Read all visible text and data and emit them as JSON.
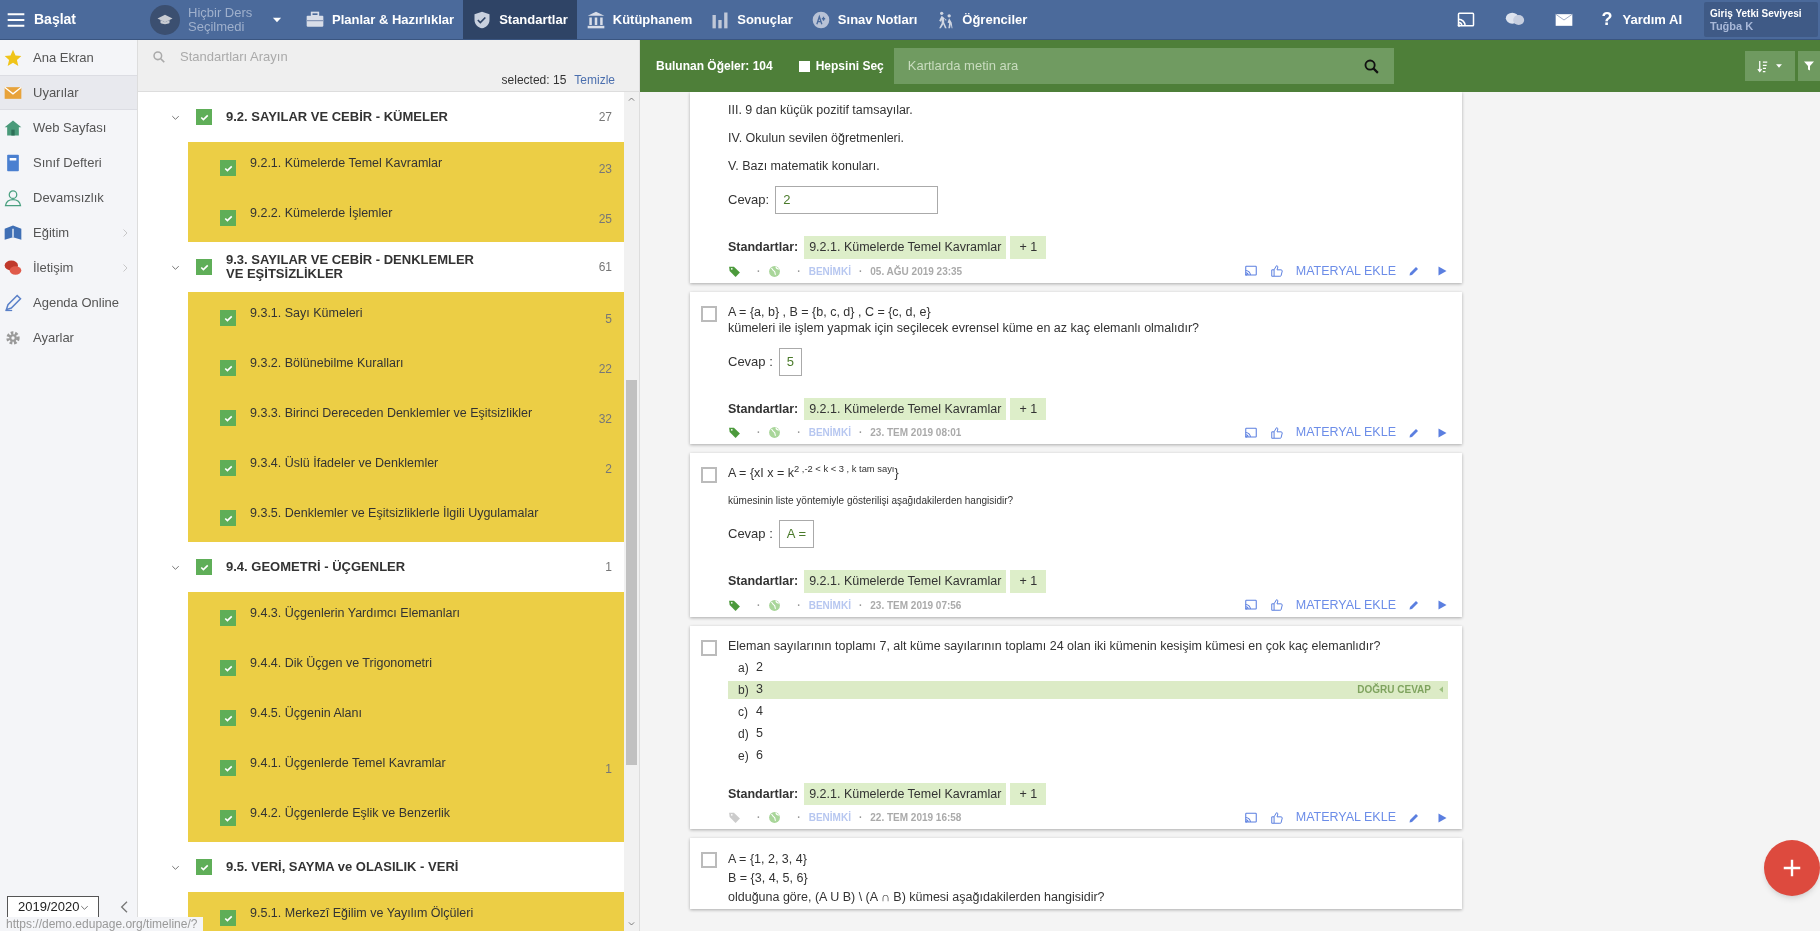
{
  "topbar": {
    "menu_label": "Başlat",
    "course": "Hiçbir Ders Seçilmedi",
    "tabs": [
      {
        "label": "Planlar & Hazırlıklar",
        "selected": false
      },
      {
        "label": "Standartlar",
        "selected": true
      },
      {
        "label": "Kütüphanem",
        "selected": false
      },
      {
        "label": "Sonuçlar",
        "selected": false
      },
      {
        "label": "Sınav Notları",
        "selected": false
      },
      {
        "label": "Öğrenciler",
        "selected": false
      }
    ],
    "help_icon": "?",
    "help": "Yardım AI",
    "user": {
      "role": "Giriş Yetki Seviyesi",
      "name": "Tuğba K"
    }
  },
  "sidebar": {
    "items": [
      {
        "label": "Ana Ekran",
        "selected": false,
        "submenu": false
      },
      {
        "label": "Uyarılar",
        "selected": true,
        "submenu": false
      },
      {
        "label": "Web Sayfası",
        "selected": false,
        "submenu": false
      },
      {
        "label": "Sınıf Defteri",
        "selected": false,
        "submenu": false
      },
      {
        "label": "Devamsızlık",
        "selected": false,
        "submenu": false
      },
      {
        "label": "Eğitim",
        "selected": false,
        "submenu": true
      },
      {
        "label": "İletişim",
        "selected": false,
        "submenu": true
      },
      {
        "label": "Agenda Online",
        "selected": false,
        "submenu": false
      },
      {
        "label": "Ayarlar",
        "selected": false,
        "submenu": false
      }
    ],
    "year": "2019/2020"
  },
  "standards": {
    "search_placeholder": "Standartları Arayın",
    "selected_text": "selected: 15",
    "clear": "Temizle",
    "groups": [
      {
        "title": "9.2. SAYILAR VE CEBİR - KÜMELER",
        "count": "27",
        "checked": true,
        "expanded": true,
        "children": [
          {
            "label": "9.2.1. Kümelerde Temel Kavramlar",
            "count": "23",
            "checked": true
          },
          {
            "label": "9.2.2. Kümelerde İşlemler",
            "count": "25",
            "checked": true
          }
        ]
      },
      {
        "title": "9.3. SAYILAR VE CEBİR - DENKLEMLER VE EŞİTSİZLİKLER",
        "count": "61",
        "checked": true,
        "expanded": true,
        "children": [
          {
            "label": "9.3.1. Sayı Kümeleri",
            "count": "5",
            "checked": true
          },
          {
            "label": "9.3.2. Bölünebilme Kuralları",
            "count": "22",
            "checked": true
          },
          {
            "label": "9.3.3. Birinci Dereceden Denklemler ve Eşitsizlikler",
            "count": "32",
            "checked": true
          },
          {
            "label": "9.3.4. Üslü İfadeler ve Denklemler",
            "count": "2",
            "checked": true
          },
          {
            "label": "9.3.5. Denklemler ve Eşitsizliklerle İlgili Uygulamalar",
            "checked": true
          }
        ]
      },
      {
        "title": "9.4. GEOMETRİ - ÜÇGENLER",
        "count": "1",
        "checked": true,
        "expanded": true,
        "children": [
          {
            "label": "9.4.3. Üçgenlerin Yardımcı Elemanları",
            "checked": true
          },
          {
            "label": "9.4.4. Dik Üçgen ve Trigonometri",
            "checked": true
          },
          {
            "label": "9.4.5. Üçgenin Alanı",
            "checked": true
          },
          {
            "label": "9.4.1. Üçgenlerde Temel Kavramlar",
            "count": "1",
            "checked": true
          },
          {
            "label": "9.4.2. Üçgenlerde Eşlik ve Benzerlik",
            "checked": true
          }
        ]
      },
      {
        "title": "9.5. VERİ, SAYMA ve OLASILIK - VERİ",
        "checked": true,
        "expanded": true,
        "children": [
          {
            "label": "9.5.1. Merkezî Eğilim ve Yayılım Ölçüleri",
            "checked": true
          }
        ]
      }
    ]
  },
  "toolbar": {
    "found": "Bulunan Öğeler: 104",
    "select_all": {
      "label": "Hepsini Seç",
      "checked": false
    },
    "search_placeholder": "Kartlarda metin ara"
  },
  "cards": [
    {
      "kind": "open",
      "lines": [
        {
          "text": "III. 9 dan küçük pozitif tamsayılar.",
          "small": false
        },
        {
          "text": "IV. Okulun sevilen öğretmenleri.",
          "small": false
        },
        {
          "text": "V. Bazı matematik konuları.",
          "small": false
        }
      ],
      "answer": {
        "label": "Cevap:",
        "value": "2",
        "wide": true
      },
      "standards": {
        "label": "Standartlar:",
        "tag": "9.2.1. Kümelerde Temel Kavramlar",
        "more": "+ 1"
      },
      "meta": {
        "tagged": true,
        "dots": [
          "·",
          "·",
          "·"
        ],
        "owner": "BENİMKİ",
        "date": "05. AĞU 2019 23:35",
        "action": "MATERYAL EKLE"
      }
    },
    {
      "kind": "open",
      "checked": false,
      "lines": [
        {
          "text": "A = {a, b} , B = {b, c, d} , C = {c, d, e}",
          "small": false
        },
        {
          "text": "kümeleri ile işlem yapmak için seçilecek evrensel küme en az kaç elemanlı olmalıdır?",
          "small": false
        }
      ],
      "answer": {
        "label": "Cevap :",
        "value": "5",
        "wide": false
      },
      "standards": {
        "label": "Standartlar:",
        "tag": "9.2.1. Kümelerde Temel Kavramlar",
        "more": "+ 1"
      },
      "meta": {
        "tagged": true,
        "dots": [
          "·",
          "·",
          "·"
        ],
        "owner": "BENİMKİ",
        "date": "23. TEM 2019 08:01",
        "action": "MATERYAL EKLE"
      }
    },
    {
      "kind": "open",
      "checked": false,
      "lines": [
        {
          "text": "A = {xI x = k$^{2 ,-2 < k < 3 , k tam sayı}$}",
          "small": false
        },
        {
          "text": "kümesinin liste yöntemiyle gösterilişi aşağıdakilerden hangisidir?",
          "small": true
        }
      ],
      "answer": {
        "label": "Cevap :",
        "value": "A =",
        "wide": false
      },
      "standards": {
        "label": "Standartlar:",
        "tag": "9.2.1. Kümelerde Temel Kavramlar",
        "more": "+ 1"
      },
      "meta": {
        "tagged": true,
        "dots": [
          "·",
          "·",
          "·"
        ],
        "owner": "BENİMKİ",
        "date": "23. TEM 2019 07:56",
        "action": "MATERYAL EKLE"
      }
    },
    {
      "kind": "choice",
      "checked": false,
      "lines": [
        {
          "text": "Eleman sayılarının toplamı 7, alt küme sayılarının toplamı 24 olan iki kümenin kesişim kümesi en çok kaç elemanlıdır?",
          "small": false
        }
      ],
      "options": [
        {
          "letter": "a)",
          "text": "2",
          "correct": false
        },
        {
          "letter": "b)",
          "text": "3",
          "correct": true
        },
        {
          "letter": "c)",
          "text": "4",
          "correct": false
        },
        {
          "letter": "d)",
          "text": "5",
          "correct": false
        },
        {
          "letter": "e)",
          "text": "6",
          "correct": false
        }
      ],
      "correct_label": "DOĞRU CEVAP",
      "standards": {
        "label": "Standartlar:",
        "tag": "9.2.1. Kümelerde Temel Kavramlar",
        "more": "+ 1"
      },
      "meta": {
        "tagged": false,
        "dots": [
          "·",
          "·",
          "·"
        ],
        "owner": "BENİMKİ",
        "date": "22. TEM 2019 16:58",
        "action": "MATERYAL EKLE"
      }
    },
    {
      "kind": "text",
      "checked": false,
      "lines": [
        {
          "text": "A = {1, 2, 3, 4}",
          "small": false
        },
        {
          "text": "B = {3, 4, 5, 6}",
          "small": false
        },
        {
          "text": "olduğuna göre, (A U B) \\ (A ∩ B) kümesi aşağıdakilerden hangisidir?",
          "small": false
        }
      ]
    }
  ],
  "status_url": "https://demo.edupage.org/timeline/?"
}
